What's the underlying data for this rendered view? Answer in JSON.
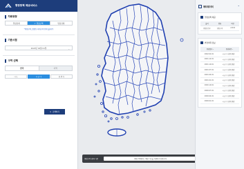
{
  "brand": {
    "title": "행정정책 제공서비스"
  },
  "data_type": {
    "heading": "자료유형",
    "options": [
      "행정경계",
      "행정구역",
      "법정경계"
    ],
    "selected_index": 1,
    "note": "*행정구역_법정동 하위구역 연계 불가(?)"
  },
  "base_date": {
    "heading": "기준시점",
    "value": "2022년 02월 01일"
  },
  "region": {
    "heading": "구역 선택",
    "scope_options": [
      "전국",
      "지역"
    ],
    "level_options": [
      "시·도",
      "시·군·구",
      "읍·면·동"
    ],
    "level_selected_index": 1,
    "query_button": "검색하기"
  },
  "bottom_bar": {
    "label": "행정구역 경계 다운",
    "message": "행정구역에서는 해당 기능을 지원하지 않습니다.",
    "download_button": "다운로드"
  },
  "right_panel": {
    "title": "메타데이터",
    "collapse_icon": "chevron-up-icon",
    "metadata": {
      "title": "행정정책 제공",
      "columns": [
        "출처",
        "명칭",
        "버전"
      ],
      "values": [
        "행정안전부",
        "행정구역",
        "v2022"
      ]
    },
    "history": {
      "title": "변경이력 정보",
      "columns": [
        "변경일자",
        "변경내용"
      ],
      "rows": [
        [
          "2022.02.01",
          "시·군·구 경계 변경"
        ],
        [
          "2021.12.01",
          "시·군·구 경계 변경"
        ],
        [
          "2021.10.01",
          "시·군·구 경계 변경"
        ],
        [
          "2021.07.01",
          "시·군·구 경계 변경"
        ],
        [
          "2021.04.01",
          "시·군·구 경계 변경"
        ],
        [
          "2021.01.01",
          "시·군·구 경계 변경"
        ],
        [
          "2020.10.01",
          "시·군·구 경계 변경"
        ],
        [
          "2020.07.01",
          "시·군·구 경계 변경"
        ],
        [
          "2020.04.01",
          "시·군·구 경계 변경"
        ],
        [
          "2020.01.01",
          "시·군·구 경계 변경"
        ]
      ]
    }
  },
  "colors": {
    "brand": "#1d3d7b",
    "accent": "#2b8ee0",
    "boundary": "#1f3fb0",
    "land": "#f4f5f7",
    "sea": "#e9ebee"
  }
}
